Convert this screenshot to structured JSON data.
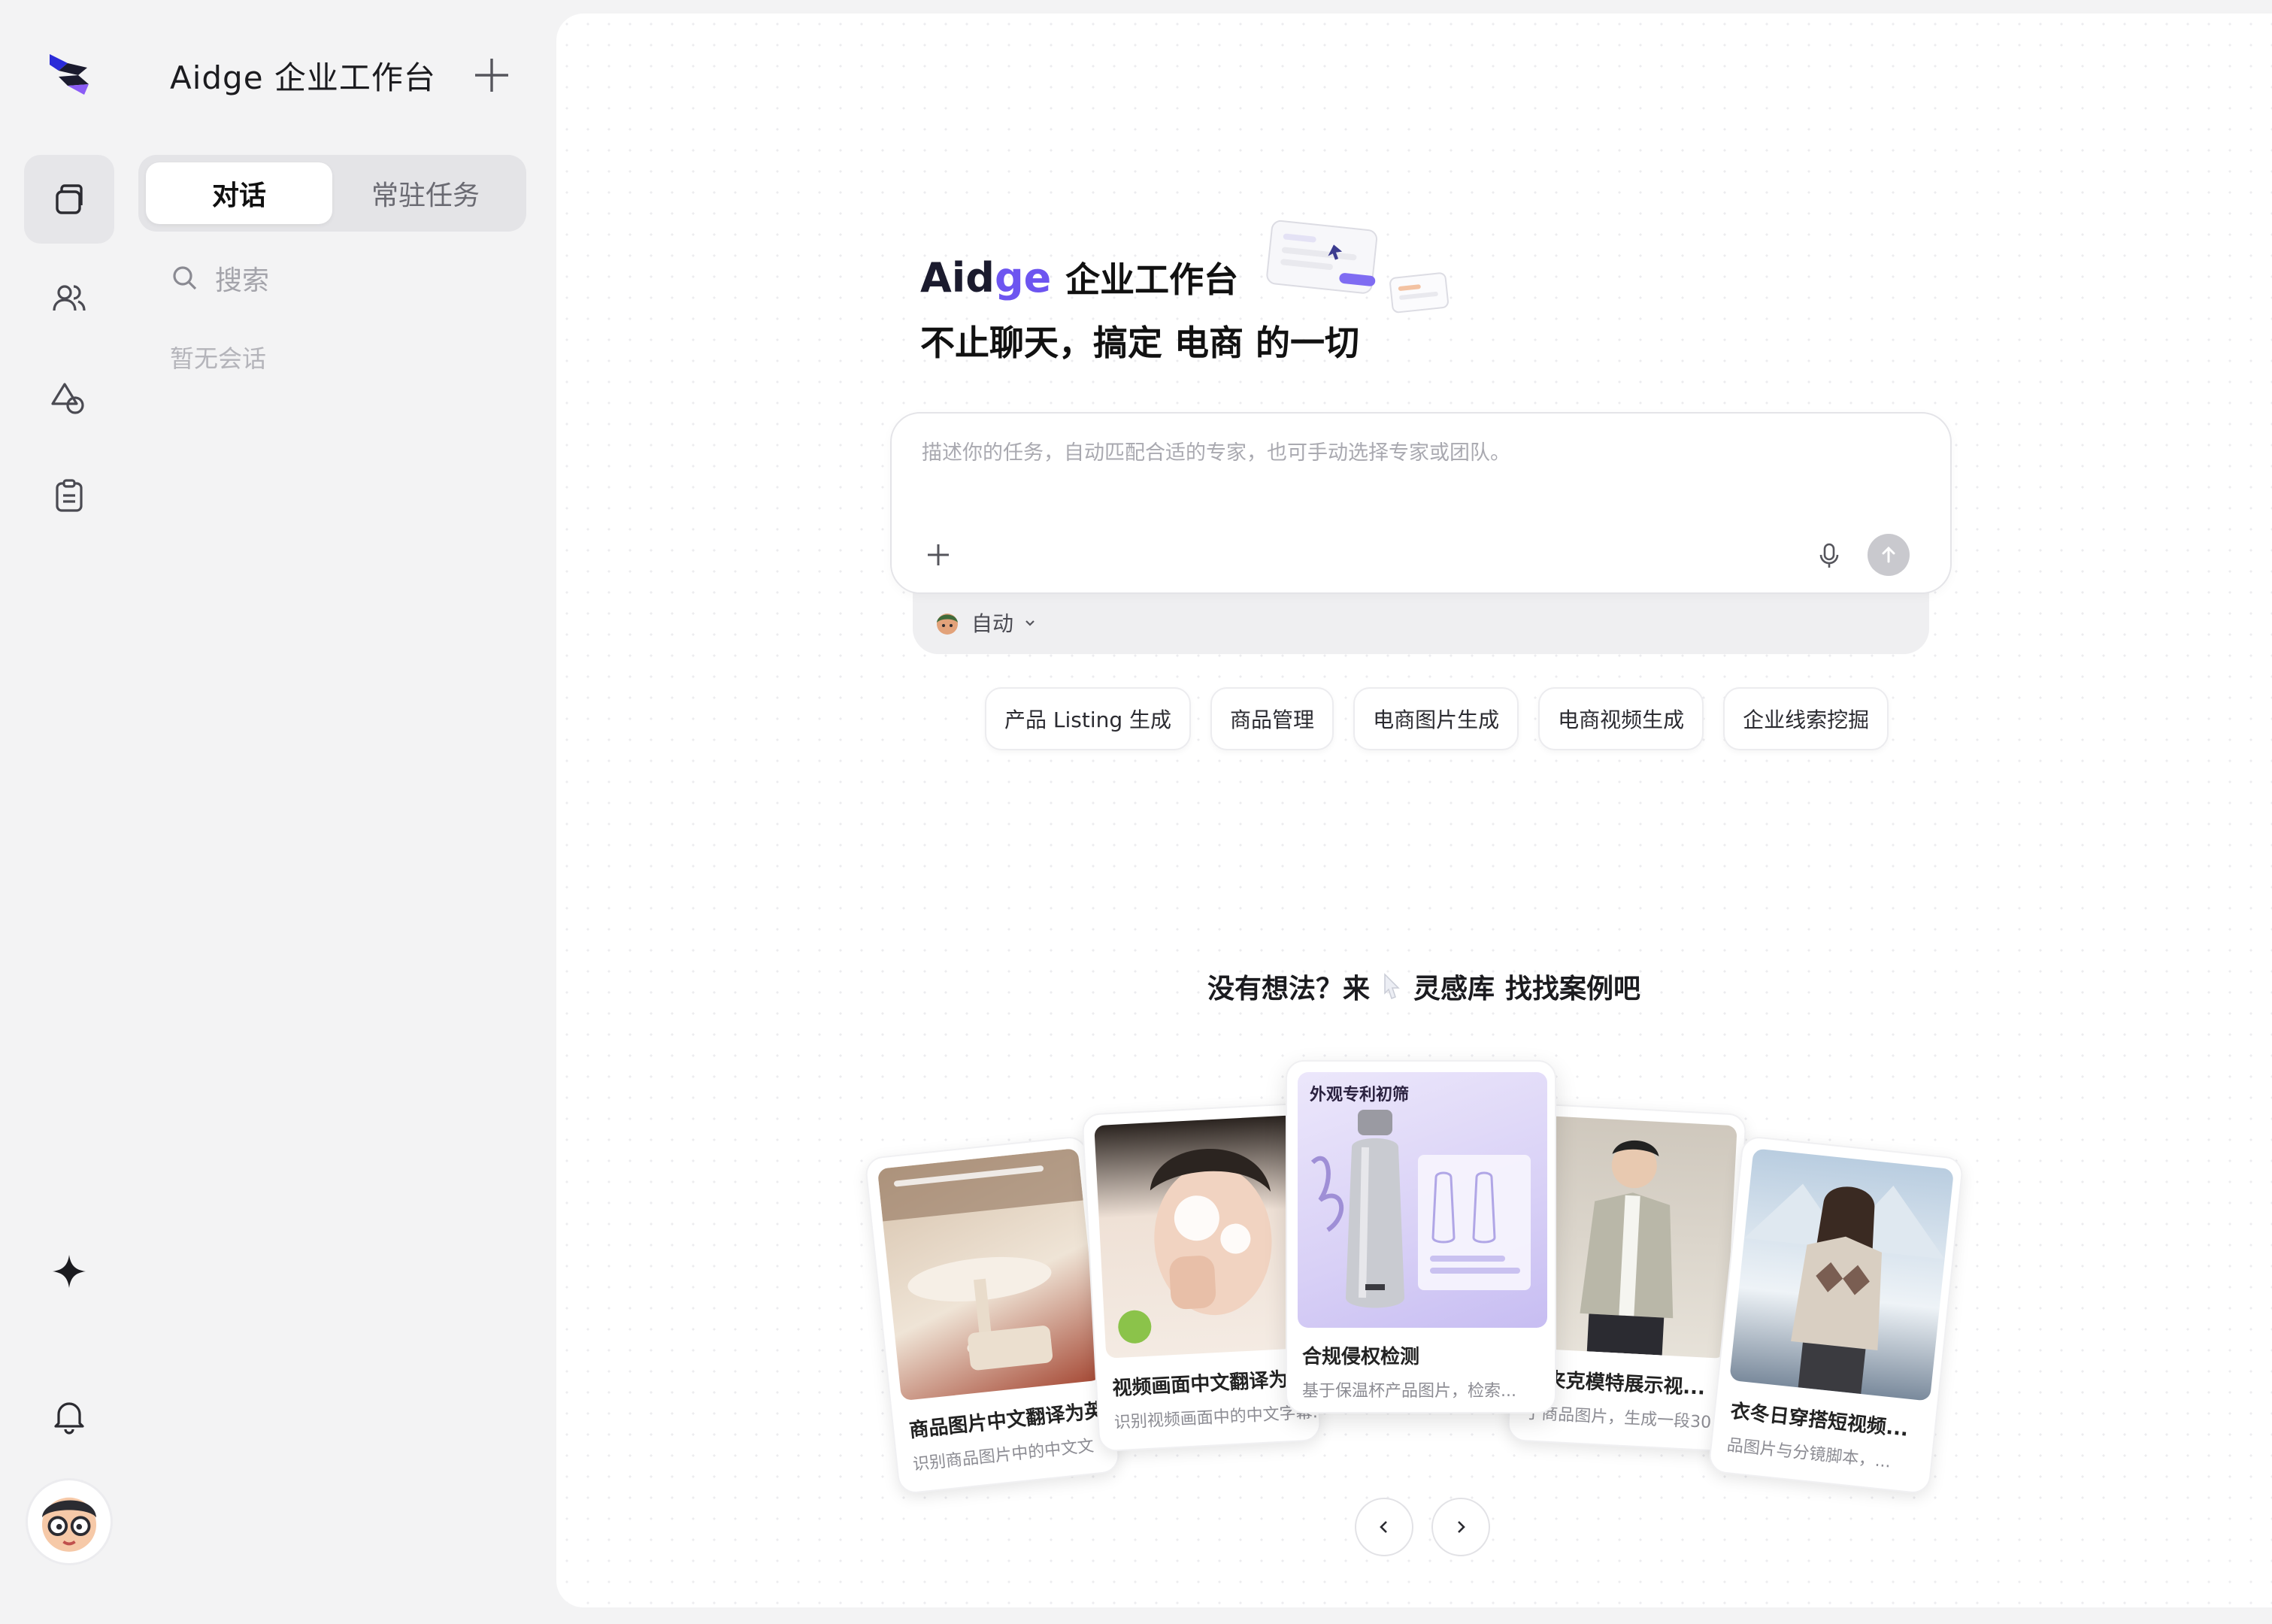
{
  "workspace": {
    "title": "Aidge 企业工作台"
  },
  "sidebar": {
    "tabs": [
      "对话",
      "常驻任务"
    ],
    "search_placeholder": "搜索",
    "empty_text": "暂无会话"
  },
  "hero": {
    "brand_first": "Aid",
    "brand_second": "ge",
    "title_rest": "企业工作台",
    "subtitle": "不止聊天，搞定 电商 的一切"
  },
  "composer": {
    "placeholder": "描述你的任务，自动匹配合适的专家，也可手动选择专家或团队。",
    "agent_mode": "自动"
  },
  "chips": [
    "产品 Listing 生成",
    "商品管理",
    "电商图片生成",
    "电商视频生成",
    "企业线索挖掘"
  ],
  "inspiration": {
    "before": "没有想法？来",
    "library": "灵感库",
    "after": "找找案例吧"
  },
  "cards": [
    {
      "title": "商品图片中文翻译为英",
      "desc": "识别商品图片中的中文文"
    },
    {
      "title": "视频画面中文翻译为",
      "desc": "识别视频画面中的中文字幕..."
    },
    {
      "title": "合规侵权检测",
      "desc": "基于保温杯产品图片，检索...",
      "badge": "外观专利初筛"
    },
    {
      "title": "闲夹克模特展示视...",
      "desc": "于商品图片，生成一段30..."
    },
    {
      "title": "衣冬日穿搭短视频...",
      "desc": "品图片与分镜脚本，..."
    }
  ],
  "colors": {
    "brand_purple": "#6d55f0",
    "rail_active": "#e6e6e9",
    "panel_bg": "#ffffff"
  }
}
